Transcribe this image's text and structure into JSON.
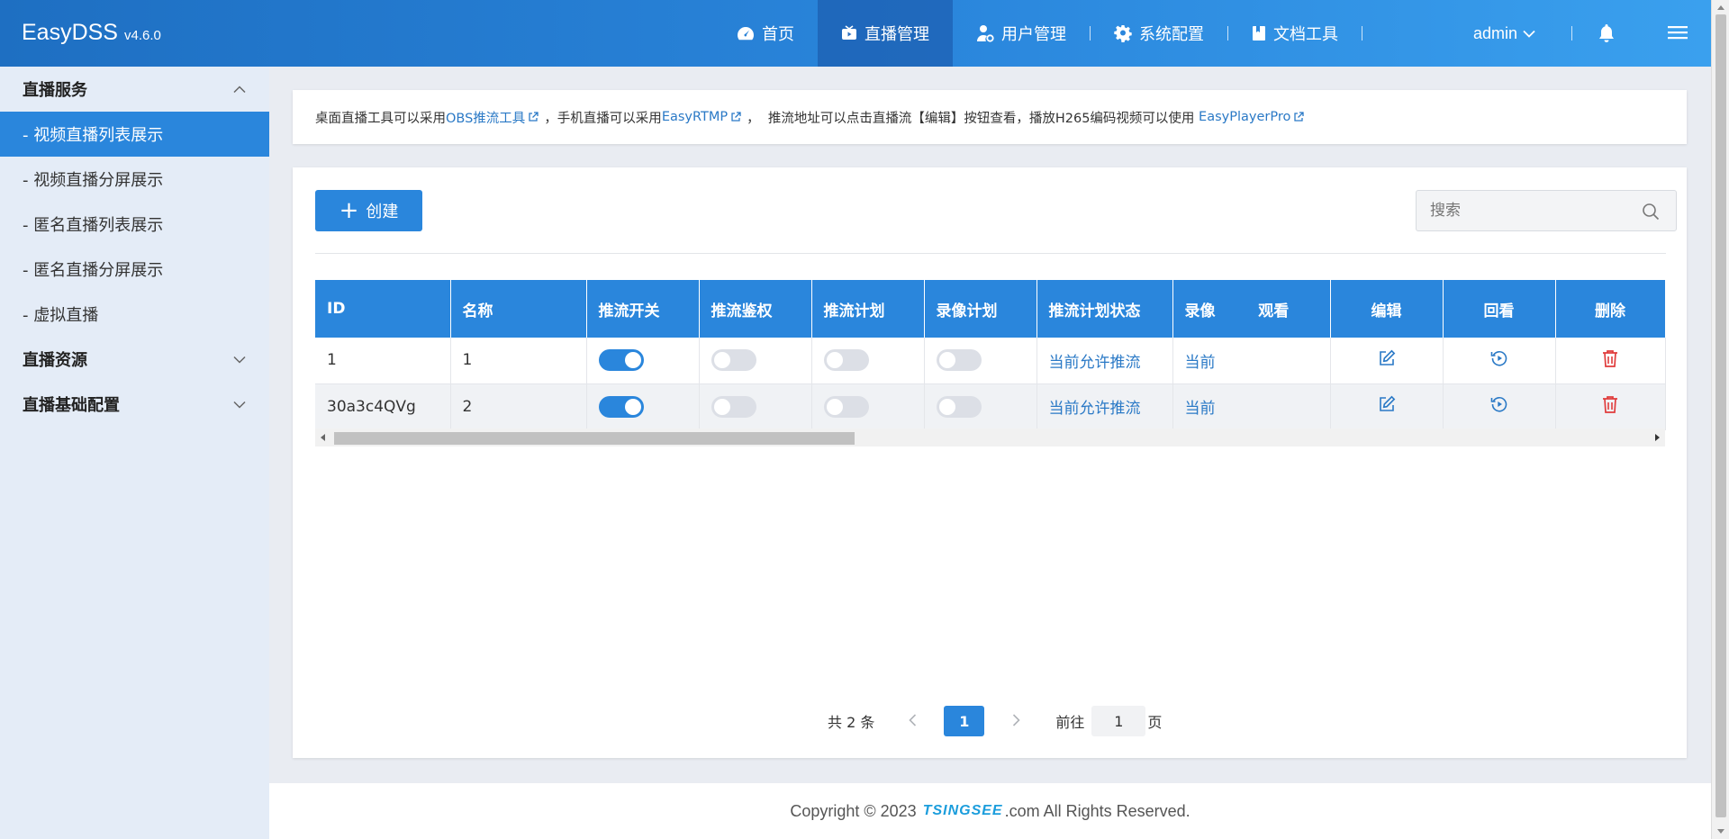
{
  "app": {
    "name": "EasyDSS",
    "version": "v4.6.0"
  },
  "nav": {
    "items": [
      {
        "label": "首页",
        "icon": "dashboard-icon"
      },
      {
        "label": "直播管理",
        "icon": "live-tv-icon",
        "active": true
      },
      {
        "label": "用户管理",
        "icon": "user-gear-icon"
      },
      {
        "label": "系统配置",
        "icon": "gear-icon"
      },
      {
        "label": "文档工具",
        "icon": "book-icon"
      }
    ],
    "user": "admin"
  },
  "sidebar": {
    "groups": [
      {
        "label": "直播服务",
        "expanded": true
      },
      {
        "label": "直播资源",
        "expanded": false
      },
      {
        "label": "直播基础配置",
        "expanded": false
      }
    ],
    "items": [
      {
        "label": "- 视频直播列表展示",
        "active": true
      },
      {
        "label": "- 视频直播分屏展示"
      },
      {
        "label": "- 匿名直播列表展示"
      },
      {
        "label": "- 匿名直播分屏展示"
      },
      {
        "label": "- 虚拟直播"
      }
    ]
  },
  "notice": {
    "t1": "桌面直播工具可以采用 ",
    "link1": "OBS推流工具",
    "t2": "，手机直播可以采用 ",
    "link2": "EasyRTMP",
    "t3": "，  推流地址可以点击直播流【编辑】按钮查看，播放H265编码视频可以使用 ",
    "link3": "EasyPlayerPro"
  },
  "toolbar": {
    "create_label": "创建",
    "search_placeholder": "搜索"
  },
  "table": {
    "headers": [
      "ID",
      "名称",
      "推流开关",
      "推流鉴权",
      "推流计划",
      "录像计划",
      "推流计划状态",
      "录像",
      "观看",
      "编辑",
      "回看",
      "删除"
    ],
    "rows": [
      {
        "id": "1",
        "name": "1",
        "push": true,
        "auth": false,
        "plan": false,
        "record": false,
        "status": "当前允许推流",
        "rec_status": "当前"
      },
      {
        "id": "30a3c4QVg",
        "name": "2",
        "push": true,
        "auth": false,
        "plan": false,
        "record": false,
        "status": "当前允许推流",
        "rec_status": "当前"
      }
    ]
  },
  "pagination": {
    "total": "共 2 条",
    "current": "1",
    "goto_prefix": "前往",
    "goto_value": "1",
    "goto_suffix": "页"
  },
  "footer": {
    "prefix": "Copyright © 2023 ",
    "brand": "TSINGSEE",
    "suffix": ".com All Rights Reserved."
  },
  "colors": {
    "primary": "#2a86dc",
    "link": "#2a79c6",
    "delete": "#e03b3b"
  }
}
